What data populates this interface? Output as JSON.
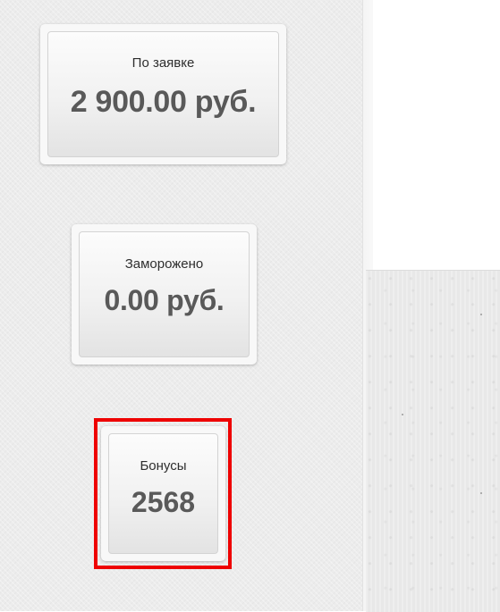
{
  "balances": [
    {
      "label": "По заявке",
      "value": "2 900.00 руб."
    },
    {
      "label": "Заморожено",
      "value": "0.00 руб."
    },
    {
      "label": "Бонусы",
      "value": "2568"
    }
  ],
  "colors": {
    "highlight_border": "#ee0000",
    "value_text": "#595959",
    "label_text": "#2e2e2e"
  }
}
